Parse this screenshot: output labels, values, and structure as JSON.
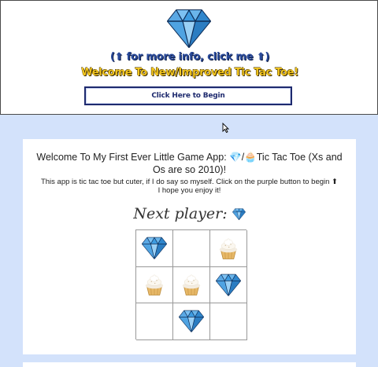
{
  "header": {
    "logo_icon": "diamond-icon",
    "info_link": "(⬆ for more info, click me ⬆)",
    "welcome_banner": "Welcome To New/Improved Tic Tac Toe!",
    "begin_button_label": "Click Here to Begin"
  },
  "card": {
    "title": "Welcome To My First Ever Little Game App: 💎/🧁Tic Tac Toe (Xs and Os are so 2010)!",
    "description_line1": "This app is tic tac toe but cuter, if I do say so myself. Click on the purple button to begin ⬆",
    "description_line2": "I hope you enjoy it!",
    "next_player_label": "Next player:",
    "next_player_icon": "diamond-icon"
  },
  "board": {
    "cells": [
      "diamond",
      "",
      "cupcake",
      "cupcake",
      "cupcake",
      "diamond",
      "",
      "diamond",
      ""
    ]
  },
  "colors": {
    "page_background": "#d3e2fb",
    "diamond": "#3d9be0",
    "banner_yellow": "#f2c51f",
    "button_border": "#1e2a6e"
  }
}
